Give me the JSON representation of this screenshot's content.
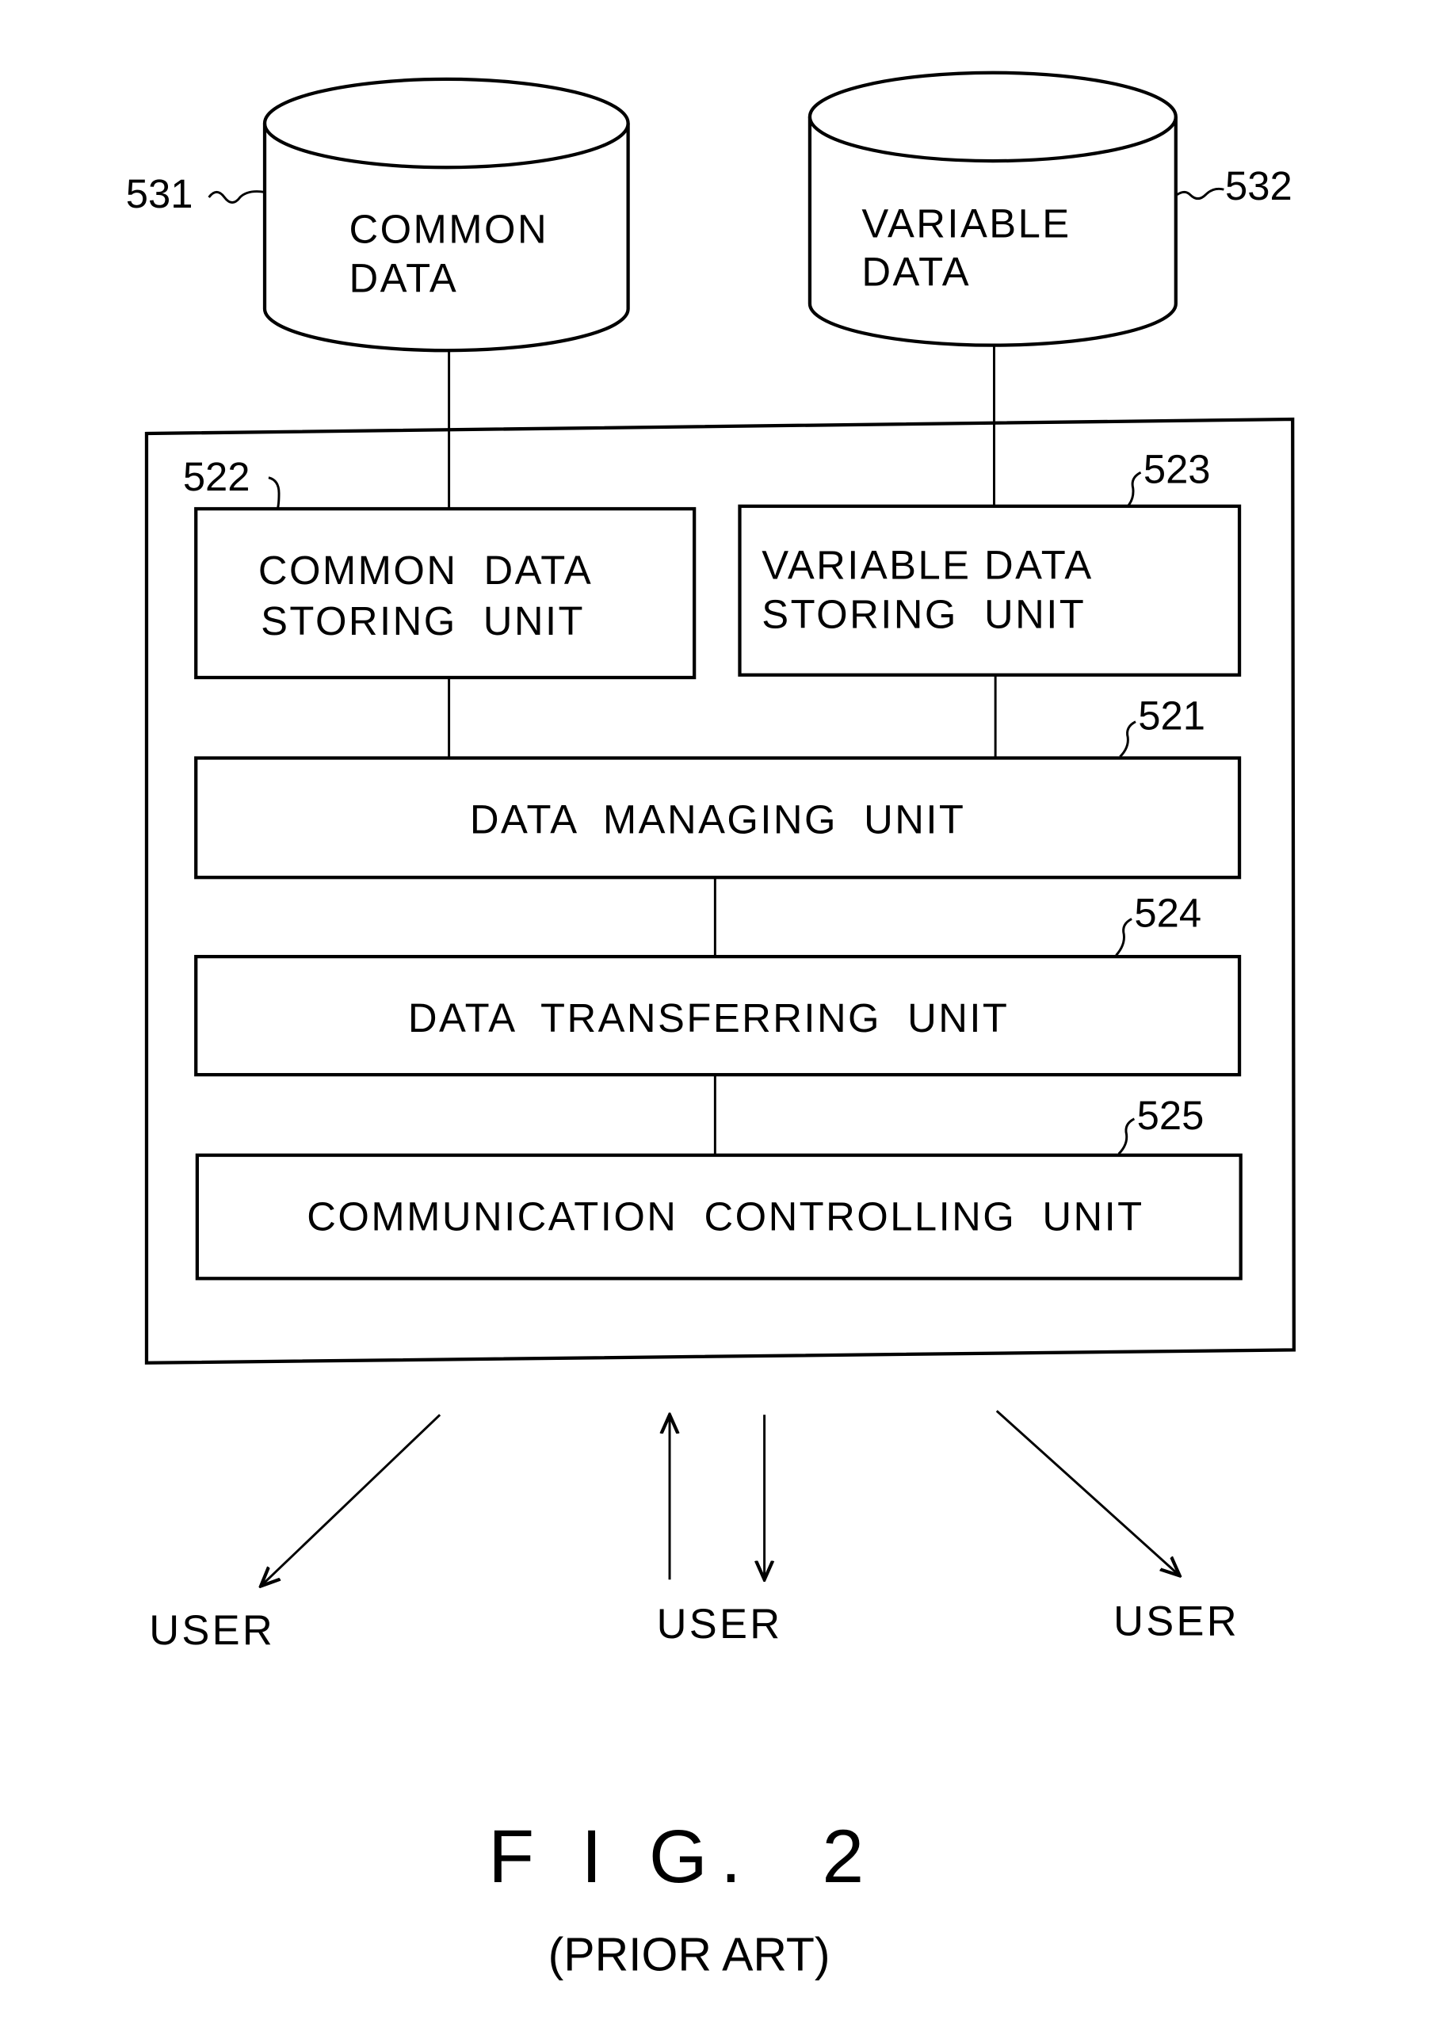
{
  "figure": {
    "title": "F I G.  2",
    "subtitle": "(PRIOR ART)"
  },
  "databases": [
    {
      "ref": "531",
      "line1": "COMMON",
      "line2": "DATA"
    },
    {
      "ref": "532",
      "line1": "VARIABLE",
      "line2": "DATA"
    }
  ],
  "units": {
    "common_storing": {
      "ref": "522",
      "line1": "COMMON  DATA",
      "line2": "STORING  UNIT"
    },
    "variable_storing": {
      "ref": "523",
      "line1": "VARIABLE DATA",
      "line2": "STORING  UNIT"
    },
    "managing": {
      "ref": "521",
      "label": "DATA  MANAGING  UNIT"
    },
    "transferring": {
      "ref": "524",
      "label": "DATA  TRANSFERRING  UNIT"
    },
    "communication": {
      "ref": "525",
      "label": "COMMUNICATION  CONTROLLING  UNIT"
    }
  },
  "users": [
    {
      "label": "USER",
      "direction": "outgoing"
    },
    {
      "label": "USER",
      "direction": "bidirectional"
    },
    {
      "label": "USER",
      "direction": "outgoing"
    }
  ]
}
